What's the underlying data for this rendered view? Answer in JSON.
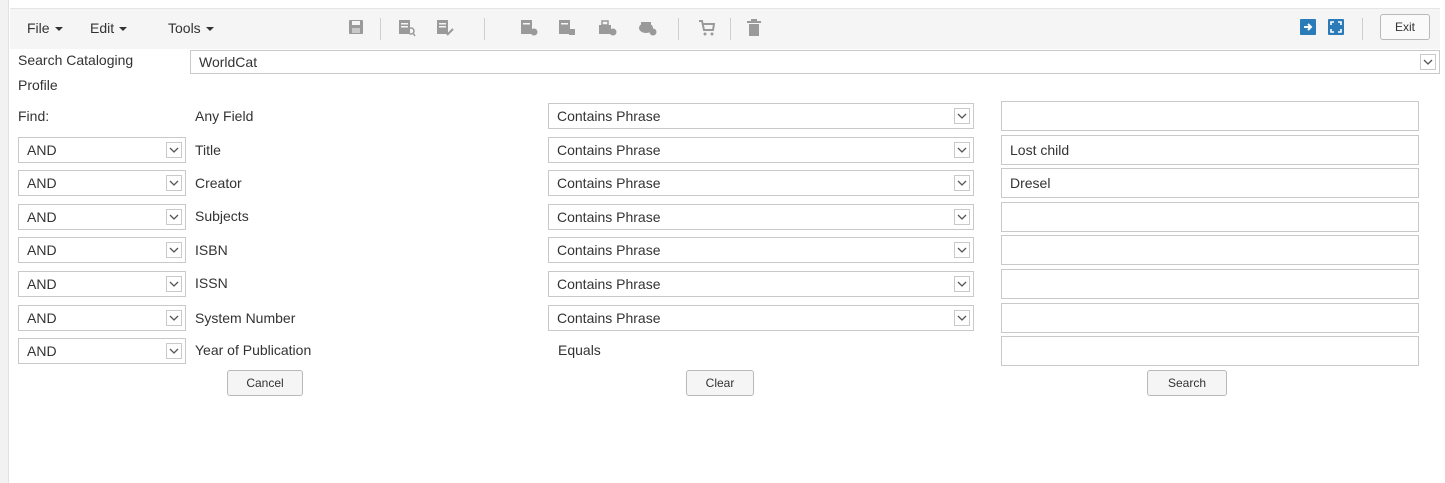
{
  "menus": {
    "file": "File",
    "edit": "Edit",
    "tools": "Tools"
  },
  "toolbar_icons": [
    "save-icon",
    "view-record-icon",
    "edit-record-icon",
    "copy-record-icon",
    "derive-record-icon",
    "import-icon",
    "export-icon",
    "cart-icon",
    "delete-icon"
  ],
  "toolbar_right": {
    "exit_label": "Exit"
  },
  "profile": {
    "label_line1": "Search Cataloging",
    "label_line2": "Profile",
    "value": "WorldCat"
  },
  "find_label": "Find:",
  "rows": [
    {
      "operator": "",
      "field": "Any Field",
      "condition": "Contains Phrase",
      "value": ""
    },
    {
      "operator": "AND",
      "field": "Title",
      "condition": "Contains Phrase",
      "value": "Lost child"
    },
    {
      "operator": "AND",
      "field": "Creator",
      "condition": "Contains Phrase",
      "value": "Dresel"
    },
    {
      "operator": "AND",
      "field": "Subjects",
      "condition": "Contains Phrase",
      "value": ""
    },
    {
      "operator": "AND",
      "field": "ISBN",
      "condition": "Contains Phrase",
      "value": ""
    },
    {
      "operator": "AND",
      "field": "ISSN",
      "condition": "Contains Phrase",
      "value": ""
    },
    {
      "operator": "AND",
      "field": "System Number",
      "condition": "Contains Phrase",
      "value": ""
    },
    {
      "operator": "AND",
      "field": "Year of Publication",
      "condition": "Equals",
      "value": ""
    }
  ],
  "buttons": {
    "cancel": "Cancel",
    "clear": "Clear",
    "search": "Search"
  },
  "colors": {
    "toolbar_bg": "#f5f5f5",
    "icon_gray": "#9a9a9a",
    "icon_blue": "#2b7bb9",
    "border": "#c9c9c9"
  }
}
